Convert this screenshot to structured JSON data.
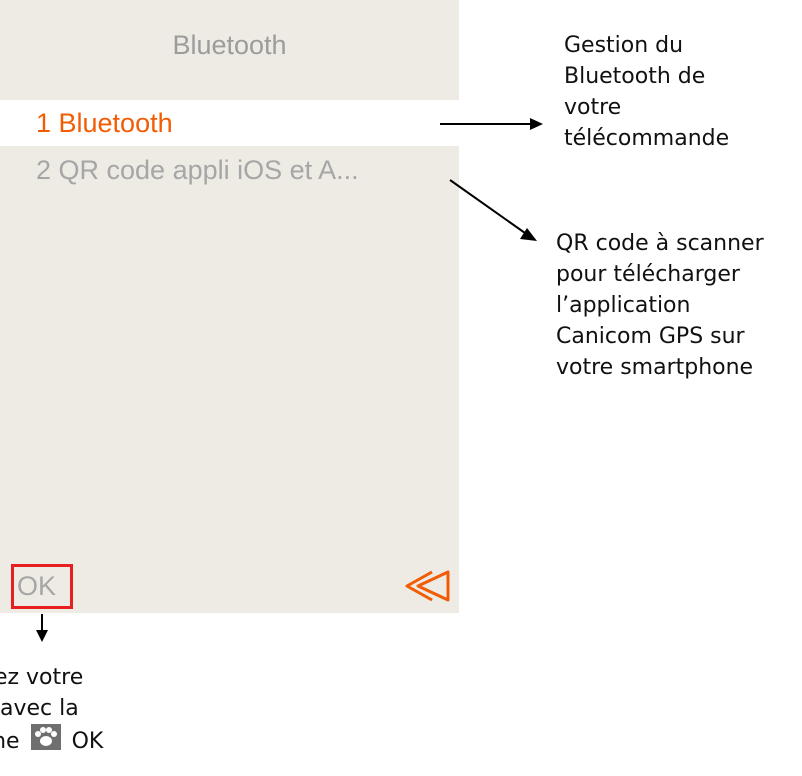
{
  "screen": {
    "title": "Bluetooth",
    "items": [
      {
        "label": "1 Bluetooth"
      },
      {
        "label": "2 QR code appli iOS et A..."
      }
    ],
    "ok_label": "OK"
  },
  "annotations": {
    "bluetooth_note": [
      "Gestion du",
      "Bluetooth de",
      "votre",
      "télécommande"
    ],
    "qr_note": [
      "QR code à scanner",
      "pour télécharger",
      "l’application",
      "Canicom GPS sur",
      "votre smartphone"
    ],
    "ok_note": [
      "dez votre",
      "x avec la",
      "che",
      "OK"
    ]
  },
  "colors": {
    "selected": "#f25c05",
    "muted": "#a6a6a6",
    "screen_bg": "#edebe4",
    "ok_border": "#e81f1f"
  },
  "icons": [
    "back-arrow-icon",
    "paw-icon"
  ]
}
